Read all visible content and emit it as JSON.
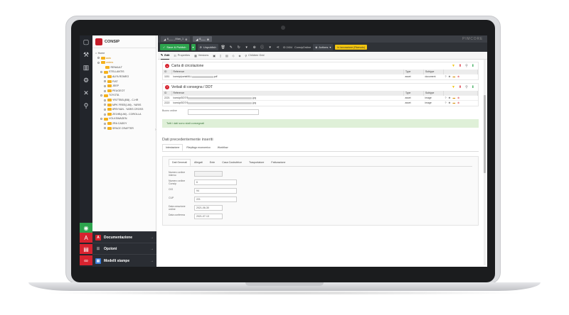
{
  "tabs": [
    {
      "label": "6___ _Man_1"
    },
    {
      "label": "6___"
    }
  ],
  "brand": "PIMCORE",
  "tree": {
    "title": "CONSIP",
    "nodes": [
      {
        "label": "Home"
      },
      {
        "label": "auto"
      },
      {
        "label": "orders"
      },
      {
        "label": "RENAULT"
      },
      {
        "label": "STELLANTIS"
      },
      {
        "label": "ALFA ROMEO"
      },
      {
        "label": "FIAT"
      },
      {
        "label": "JEEP"
      },
      {
        "label": "PEUGEOT"
      },
      {
        "label": "TOYOTA"
      },
      {
        "label": "YRI7TBEL(BB) - C-HR"
      },
      {
        "label": "MPK FREE(LIM) - YARIS"
      },
      {
        "label": "8P8YVAN - YARIS CROSS"
      },
      {
        "label": "ZE1HB(LIM) - COROLLA"
      },
      {
        "label": "VOLKSWAGEN"
      },
      {
        "label": "2RA CADDY"
      },
      {
        "label": "SPACE CRAFTER"
      }
    ]
  },
  "menus": {
    "documentazione": "Documentazione",
    "opzioni": "Opzioni",
    "modelli": "Modelli stampe"
  },
  "toolbar": {
    "save_publish": "Save & Publish",
    "unpublish": "Unpublish",
    "id_text": "ID 2404",
    "class_text": "ConsipOrdine",
    "actions": "Actions",
    "badge": "In lavorazione (Ricevuto)"
  },
  "subtabs": {
    "edit": "Edit",
    "properties": "Properties",
    "versions": "Versions",
    "children": "Children Grid"
  },
  "sections": [
    {
      "title": "Carta di circolazione",
      "columns": [
        "ID",
        "Reference",
        "Type",
        "Subtype"
      ],
      "rows": [
        {
          "id": "1151",
          "ref_pre": "/consip/portal/6LL",
          "ref_post": ".pdf",
          "type": "asset",
          "subtype": "document"
        }
      ]
    },
    {
      "title": "Verbali di consegna / DDT",
      "columns": [
        "ID",
        "Reference",
        "Type",
        "Subtype"
      ],
      "rows": [
        {
          "id": "2221",
          "ref_pre": "/consip/DDT/5",
          "ref_post": ".jpg",
          "type": "asset",
          "subtype": "image"
        },
        {
          "id": "2222",
          "ref_pre": "/consip/DDT/6",
          "ref_post": ".jpg",
          "type": "asset",
          "subtype": "image"
        }
      ]
    }
  ],
  "buono_label": "Buono ordine",
  "notice": "Tutti i dati sono stati consegnati",
  "previous": {
    "heading": "Dati precedentemente inseriti",
    "tabs": [
      "Intestazione",
      "Riepilogo economico",
      "Workflow"
    ],
    "inner_tabs": [
      "Dati Generali",
      "Allegati",
      "Ente",
      "Casa Costruttrice",
      "Trasportatore",
      "Fatturazione"
    ],
    "fields": [
      {
        "label": "Numero ordine interno",
        "value": ""
      },
      {
        "label": "Numero ordine Consip",
        "value": "6"
      },
      {
        "label": "CIG",
        "value": "94"
      },
      {
        "label": "CUP",
        "value": "221"
      },
      {
        "label": "Data creazione ordine",
        "value": "2021-06-30"
      },
      {
        "label": "Data conferma",
        "value": "2021-07-13"
      }
    ]
  },
  "colors": {
    "accent_green": "#2da44e",
    "accent_red": "#d7232f",
    "badge_yellow": "#f1c40f"
  }
}
